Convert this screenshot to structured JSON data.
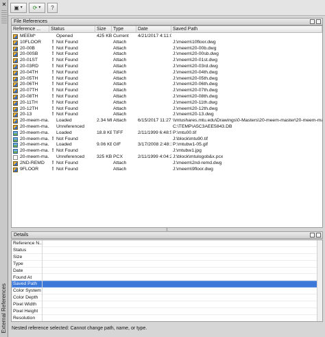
{
  "palette_title": "External References",
  "toolbar": {
    "attach_icon": "attach-dwg-icon",
    "refresh_icon": "refresh-icon",
    "help_icon": "help-icon",
    "help_label": "?"
  },
  "file_refs": {
    "title": "File References",
    "columns": [
      "Reference ...",
      "Status",
      "Size",
      "Type",
      "Date",
      "Saved Path"
    ],
    "rows": [
      {
        "icon": "dwg",
        "warn": false,
        "name": "MEEM*",
        "status": "Opened",
        "size": "425 KB",
        "type": "Current",
        "date": "4/21/2017 4:11:0...",
        "path": ""
      },
      {
        "icon": "dwg",
        "warn": true,
        "name": "10FLOOR",
        "status": "Not Found",
        "size": "",
        "type": "Attach",
        "date": "",
        "path": "J:\\meem\\10floor.dwg"
      },
      {
        "icon": "dwg",
        "warn": true,
        "name": "20-00B",
        "status": "Not Found",
        "size": "",
        "type": "Attach",
        "date": "",
        "path": "J:\\meem\\20-00b.dwg"
      },
      {
        "icon": "dwg",
        "warn": true,
        "name": "20-00SB",
        "status": "Not Found",
        "size": "",
        "type": "Attach",
        "date": "",
        "path": "J:\\meem\\20-00sb.dwg"
      },
      {
        "icon": "dwg",
        "warn": true,
        "name": "20-01ST",
        "status": "Not Found",
        "size": "",
        "type": "Attach",
        "date": "",
        "path": "J:\\meem\\20-01st.dwg"
      },
      {
        "icon": "dwg",
        "warn": true,
        "name": "20-03RD",
        "status": "Not Found",
        "size": "",
        "type": "Attach",
        "date": "",
        "path": "J:\\meem\\20-03rd.dwg"
      },
      {
        "icon": "dwg",
        "warn": true,
        "name": "20-04TH",
        "status": "Not Found",
        "size": "",
        "type": "Attach",
        "date": "",
        "path": "J:\\meem\\20-04th.dwg"
      },
      {
        "icon": "dwg",
        "warn": true,
        "name": "20-05TH",
        "status": "Not Found",
        "size": "",
        "type": "Attach",
        "date": "",
        "path": "J:\\meem\\20-05th.dwg"
      },
      {
        "icon": "dwg",
        "warn": true,
        "name": "20-06TH",
        "status": "Not Found",
        "size": "",
        "type": "Attach",
        "date": "",
        "path": "J:\\meem\\20-06th.dwg"
      },
      {
        "icon": "dwg",
        "warn": true,
        "name": "20-07TH",
        "status": "Not Found",
        "size": "",
        "type": "Attach",
        "date": "",
        "path": "J:\\meem\\20-07th.dwg"
      },
      {
        "icon": "dwg",
        "warn": true,
        "name": "20-08TH",
        "status": "Not Found",
        "size": "",
        "type": "Attach",
        "date": "",
        "path": "J:\\meem\\20-08th.dwg"
      },
      {
        "icon": "dwg",
        "warn": true,
        "name": "20-11TH",
        "status": "Not Found",
        "size": "",
        "type": "Attach",
        "date": "",
        "path": "J:\\meem\\20-11th.dwg"
      },
      {
        "icon": "dwg",
        "warn": true,
        "name": "20-12TH",
        "status": "Not Found",
        "size": "",
        "type": "Attach",
        "date": "",
        "path": "J:\\meem\\20-12th.dwg"
      },
      {
        "icon": "dwg",
        "warn": true,
        "name": "20-13",
        "status": "Not Found",
        "size": "",
        "type": "Attach",
        "date": "",
        "path": "J:\\meem\\20-13.dwg"
      },
      {
        "icon": "dwg",
        "warn": false,
        "name": "20-meem-ma...",
        "status": "Loaded",
        "size": "2.34 MB",
        "type": "Attach",
        "date": "6/15/2017 11:27:0...",
        "path": "\\\\mtushares.mtu.edu\\Drawings\\0-Masters\\20-meem-master\\20-meem-master.dwg"
      },
      {
        "icon": "dwg",
        "warn": false,
        "name": "20-meem-ma...",
        "status": "Unreferenced",
        "size": "",
        "type": "",
        "date": "",
        "path": "C:\\TEMP\\A5C3AEE5843.DB"
      },
      {
        "icon": "img",
        "warn": false,
        "name": "20-meem-ma...",
        "status": "Loaded",
        "size": "18.8 KB",
        "type": "TIFF",
        "date": "2/11/1999 6:48:5...",
        "path": "P:\\mtu00.tif"
      },
      {
        "icon": "img",
        "warn": true,
        "name": "20-meem-ma...",
        "status": "Not Found",
        "size": "",
        "type": "",
        "date": "",
        "path": "J:\\block\\mtu90.tif"
      },
      {
        "icon": "img",
        "warn": false,
        "name": "20-meem-ma...",
        "status": "Loaded",
        "size": "9.06 KB",
        "type": "GIF",
        "date": "3/17/2008 2:48:1...",
        "path": "P:\\mtubw1-05.gif"
      },
      {
        "icon": "img",
        "warn": true,
        "name": "20-meem-ma...",
        "status": "Not Found",
        "size": "",
        "type": "",
        "date": "",
        "path": "J:\\mtubw1.jpg"
      },
      {
        "icon": "pdf",
        "warn": false,
        "name": "20-meem-ma...",
        "status": "Unreferenced",
        "size": "325 KB",
        "type": "PCX",
        "date": "2/11/1999 4:04:2...",
        "path": "J:\\block\\mtulogob&x.pcx"
      },
      {
        "icon": "dwg",
        "warn": true,
        "name": "2ND-REMD",
        "status": "Not Found",
        "size": "",
        "type": "Attach",
        "date": "",
        "path": "J:\\meem\\2nd-remd.dwg"
      },
      {
        "icon": "dwg",
        "warn": true,
        "name": "9FLOOR",
        "status": "Not Found",
        "size": "",
        "type": "Attach",
        "date": "",
        "path": "J:\\meem\\9floor.dwg"
      }
    ]
  },
  "splitter_label": "‡",
  "details": {
    "title": "Details",
    "properties": [
      "Reference N...",
      "Status",
      "Size",
      "Type",
      "Date",
      "Found At",
      "Saved Path",
      "Color System",
      "Color Depth",
      "Pixel Width",
      "Pixel Height",
      "Resolution"
    ],
    "selected_index": 6
  },
  "status_text": "Nested reference selected: Cannot change path, name, or type.",
  "colors": {
    "selection": "#3b78d8",
    "warning": "#000000"
  }
}
